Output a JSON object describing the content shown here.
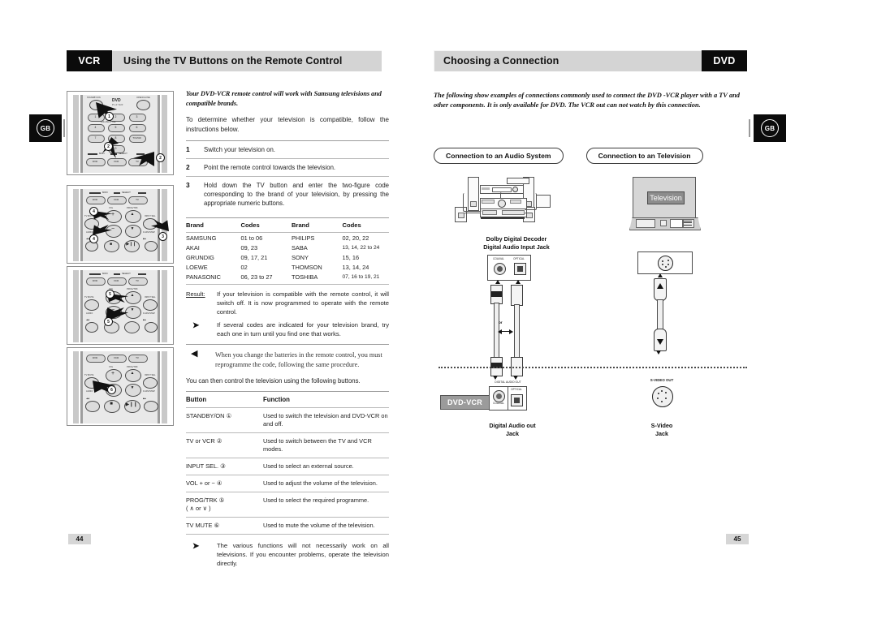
{
  "document": {
    "left_page": {
      "tag": "VCR",
      "title": "Using the TV Buttons on the Remote Control",
      "page_number": "44",
      "region_badge": "GB",
      "intro_italic": "Your DVD-VCR remote control will work with Samsung televisions and compatible brands.",
      "intro_plain": "To determine whether your television is compatible, follow the instructions below.",
      "steps": [
        {
          "num": "1",
          "text": "Switch your television on."
        },
        {
          "num": "2",
          "text": "Point the remote control towards the television."
        },
        {
          "num": "3",
          "text": "Hold down the TV button and enter the two-figure code corresponding to the brand of your television, by pressing the appropriate numeric buttons."
        }
      ],
      "codes_table": {
        "headers": [
          "Brand",
          "Codes",
          "Brand",
          "Codes"
        ],
        "rows": [
          [
            "SAMSUNG",
            "01 to 06",
            "PHILIPS",
            "02, 20, 22"
          ],
          [
            "AKAI",
            "09, 23",
            "SABA",
            "13, 14, 22 to 24"
          ],
          [
            "GRUNDIG",
            "09, 17, 21",
            "SONY",
            "15, 16"
          ],
          [
            "LOEWE",
            "02",
            "THOMSON",
            "13, 14, 24"
          ],
          [
            "PANASONIC",
            "06, 23 to 27",
            "TOSHIBA",
            "07, 16 to 19, 21"
          ]
        ]
      },
      "result_label": "Result:",
      "result_text": "If your television is compatible with the remote control, it will switch off. It is now programmed to operate with the remote control.",
      "bullet_note": "If several codes are indicated for your television brand, try each one in turn until you find one that works.",
      "tip_note": "When you change the batteries in the remote control, you must reprogramme the code, following the same procedure.",
      "after_tip": "You can then control the television using the following buttons.",
      "button_table": {
        "headers": [
          "Button",
          "Function"
        ],
        "rows": [
          [
            "STANDBY/ON ①",
            "Used to switch the television and DVD-VCR on and off."
          ],
          [
            "TV or VCR ②",
            "Used to switch between the TV and VCR modes."
          ],
          [
            "INPUT SEL. ③",
            "Used to select an external source."
          ],
          [
            "VOL + or −  ④",
            "Used to adjust the volume of the television."
          ],
          [
            "PROG/TRK ⑤\n( ∧ or ∨ )",
            "Used to select the required programme."
          ],
          [
            "TV MUTE ⑥",
            "Used to mute the volume of the television."
          ]
        ]
      },
      "final_note": "The various functions will not necessarily work on all televisions. If you encounter problems, operate the television directly.",
      "remote_images": [
        {
          "name": "remote-standby-numeric",
          "callouts": [
            "1",
            "2"
          ],
          "keys": [
            "STANDBY/ON",
            "OPEN/CLOSE",
            "1",
            "2",
            "3",
            "4",
            "5",
            "6",
            "7",
            "8",
            "9",
            "100+/SHUTTLE",
            "0",
            "DVD",
            "VCR",
            "TV"
          ]
        },
        {
          "name": "remote-vol-inputsel",
          "callouts": [
            "3",
            "4"
          ],
          "keys": [
            "DVD",
            "VCR",
            "TV",
            "VOL",
            "PROG/TRK",
            "TV MUTE",
            "AUDIO",
            "INPUT SEL.",
            "F.ADV/STEP"
          ]
        },
        {
          "name": "remote-progtrk",
          "callouts": [
            "5"
          ],
          "keys": [
            "DVD",
            "VCR",
            "TV",
            "VOL",
            "PROG/TRK",
            "TV MUTE",
            "AUDIO",
            "INPUT SEL.",
            "F.ADV/STEP"
          ]
        },
        {
          "name": "remote-tvmute",
          "callouts": [
            "6"
          ],
          "keys": [
            "DVD",
            "VCR",
            "TV",
            "VOL",
            "PROG/TRK",
            "TV MUTE",
            "AUDIO",
            "INPUT SEL.",
            "F.ADV/STEP"
          ]
        }
      ]
    },
    "right_page": {
      "tag": "DVD",
      "title": "Choosing a Connection",
      "page_number": "45",
      "region_badge": "GB",
      "intro_italic": "The following show examples of connections commonly used to connect the DVD -VCR player with a TV and other components. It is only available for DVD. The VCR out can not watch by this connection.",
      "panels": [
        {
          "title": "Connection to an Audio System",
          "device_caption": "Dolby Digital Decoder\nDigital Audio Input Jack",
          "device_caption_line1": "Dolby Digital Decoder",
          "device_caption_line2": "Digital Audio Input Jack",
          "input_jack_labels": [
            "COAXIAL",
            "OPTICAL"
          ],
          "cable_middle_label": "or",
          "output_panel_label": "DIGITAL AUDIO OUT",
          "output_jack_labels": [
            "COAXIAL",
            "OPTICAL"
          ],
          "bottom_caption_line1": "Digital Audio out",
          "bottom_caption_line2": "Jack"
        },
        {
          "title": "Connection to an Television",
          "device_label": "Television",
          "output_label": "S-VIDEO OUT",
          "bottom_caption_line1": "S-Video",
          "bottom_caption_line2": "Jack"
        }
      ],
      "player_tag": "DVD-VCR"
    }
  },
  "colors": {
    "header_bar": "#d4d4d4",
    "tag_black": "#0b0b0b",
    "page_number_bg": "#d6d6d6",
    "player_tag_bg": "#9b9b9b",
    "tv_screen": "#8c8c8c"
  }
}
